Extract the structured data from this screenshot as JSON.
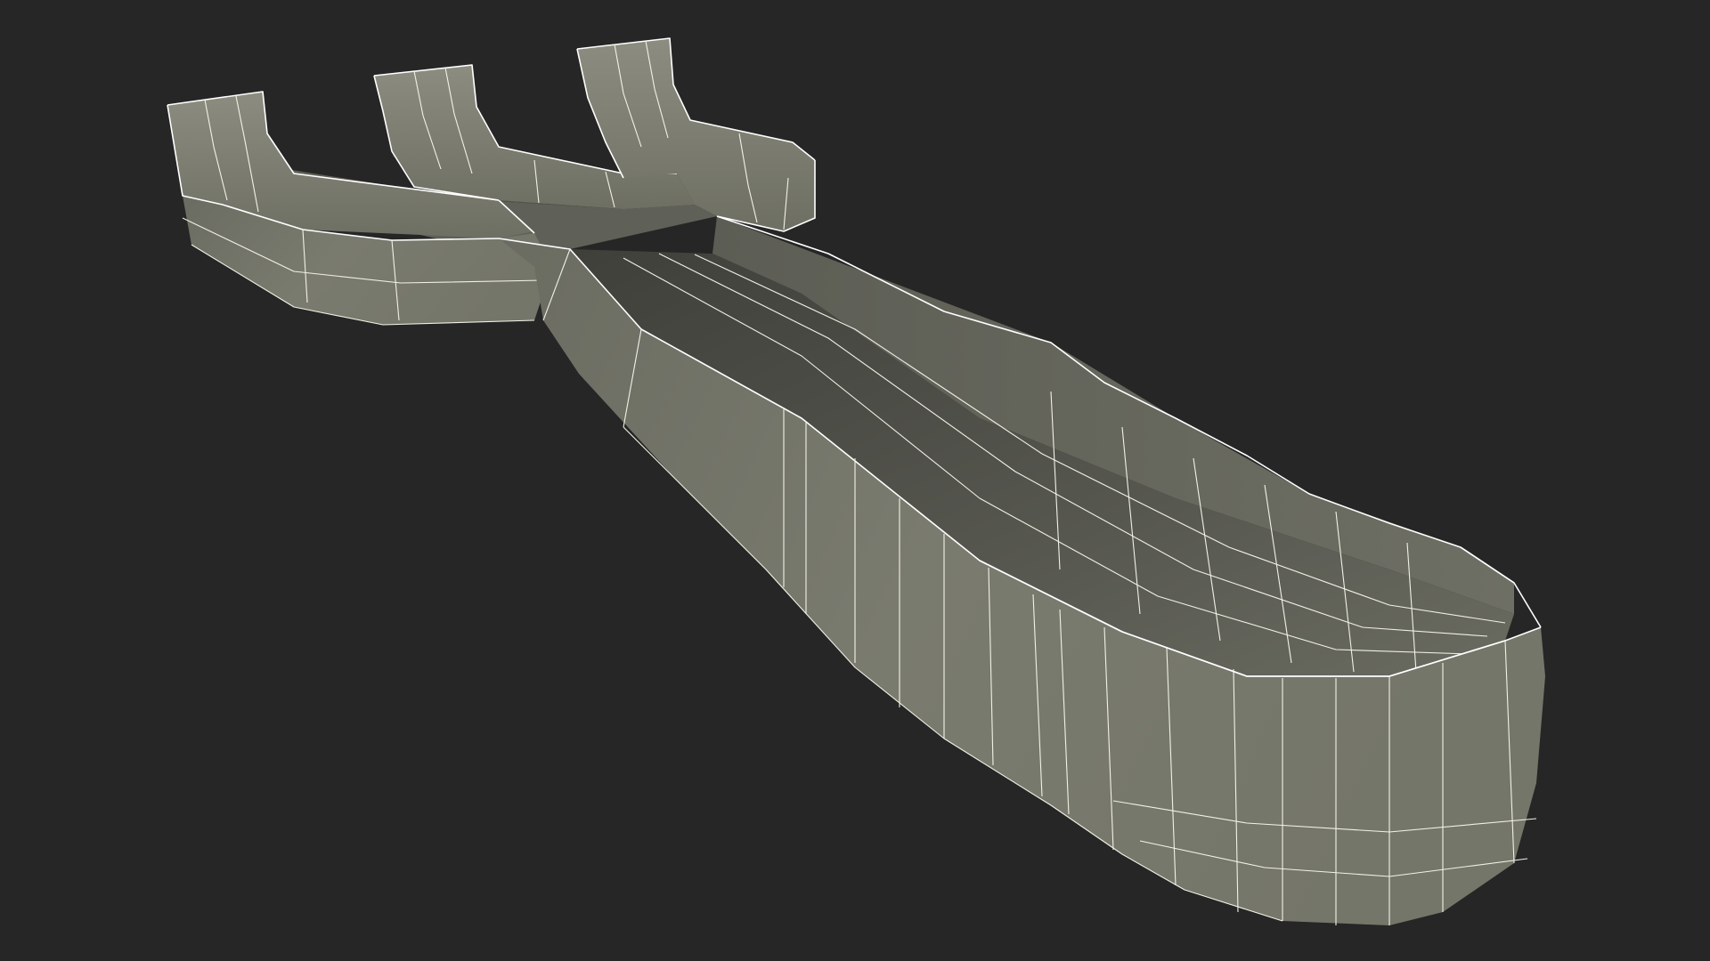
{
  "scene": {
    "subject": "wireframe-render-3d-model",
    "colors": {
      "background": "#262626",
      "surface_light": "#8a8b7e",
      "surface_mid": "#76776b",
      "surface_dark": "#4a4b44",
      "interior": "#5a5b52",
      "wire": "#f2f1e6"
    }
  }
}
